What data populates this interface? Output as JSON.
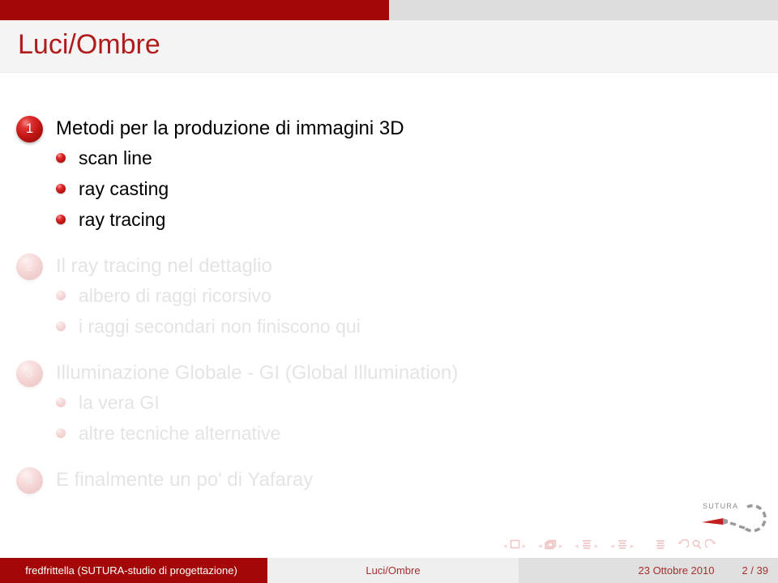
{
  "header": {
    "title": "Luci/Ombre",
    "accent_color": "#a30707",
    "title_color": "#b01c1c"
  },
  "outline": {
    "sections": [
      {
        "number": "1",
        "title": "Metodi per la produzione di immagini 3D",
        "active": true,
        "items": [
          "scan line",
          "ray casting",
          "ray tracing"
        ]
      },
      {
        "number": "2",
        "title": "Il ray tracing nel dettaglio",
        "active": false,
        "items": [
          "albero di raggi ricorsivo",
          "i raggi secondari non finiscono qui"
        ]
      },
      {
        "number": "3",
        "title": "Illuminazione Globale - GI (Global Illumination)",
        "active": false,
        "items": [
          "la vera GI",
          "altre tecniche alternative"
        ]
      },
      {
        "number": "4",
        "title": "E finalmente un po' di Yafaray",
        "active": false,
        "items": []
      }
    ]
  },
  "logo": {
    "text": "SUTURA"
  },
  "navigation": {
    "groups": [
      {
        "prev": "◂",
        "symbol": "frame-icon",
        "next": "▸"
      },
      {
        "prev": "◂",
        "symbol": "frames-stack-icon",
        "next": "▸"
      },
      {
        "prev": "◂",
        "symbol": "subsection-icon",
        "next": "▸"
      },
      {
        "prev": "◂",
        "symbol": "section-icon",
        "next": "▸"
      }
    ],
    "doc_icon": "document-icon",
    "back_icon": "go-back-icon",
    "search_icon": "search-icon",
    "forward_icon": "go-forward-icon"
  },
  "footer": {
    "author": "fredfrittella (SUTURA-studio di progettazione)",
    "title": "Luci/Ombre",
    "date": "23 Ottobre 2010",
    "page": "2 / 39"
  }
}
